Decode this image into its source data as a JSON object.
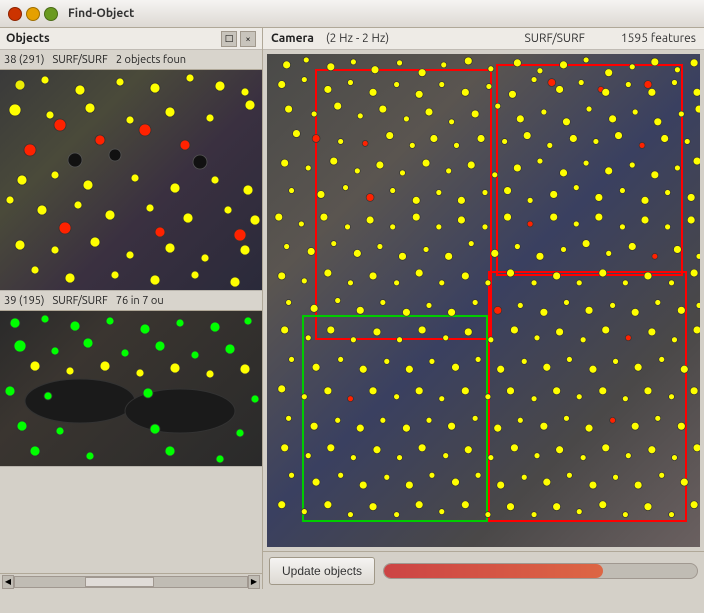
{
  "window": {
    "title": "Find-Object"
  },
  "menu": {
    "items": [
      "Objects"
    ]
  },
  "objects_panel": {
    "title": "Objects",
    "icon1": "□",
    "icon2": "×"
  },
  "object1": {
    "id": "38 (291)",
    "algo": "SURF/SURF",
    "status": "2 objects foun"
  },
  "object2": {
    "id": "39 (195)",
    "algo": "SURF/SURF",
    "status": "76 in 7 ou"
  },
  "camera": {
    "title": "Camera",
    "freq": "(2 Hz - 2 Hz)",
    "algo": "SURF/SURF",
    "features": "1595 features"
  },
  "scrollbar": {
    "label": ""
  },
  "buttons": {
    "update": "Update objects"
  },
  "colors": {
    "accent": "#cc4444",
    "dot_yellow": "#ffff00",
    "dot_red": "#ff0000",
    "dot_green": "#00ff00",
    "dot_dark": "#222222",
    "rect_red": "#ff0000",
    "rect_green": "#00cc00",
    "rect_blue": "#4488ff"
  }
}
